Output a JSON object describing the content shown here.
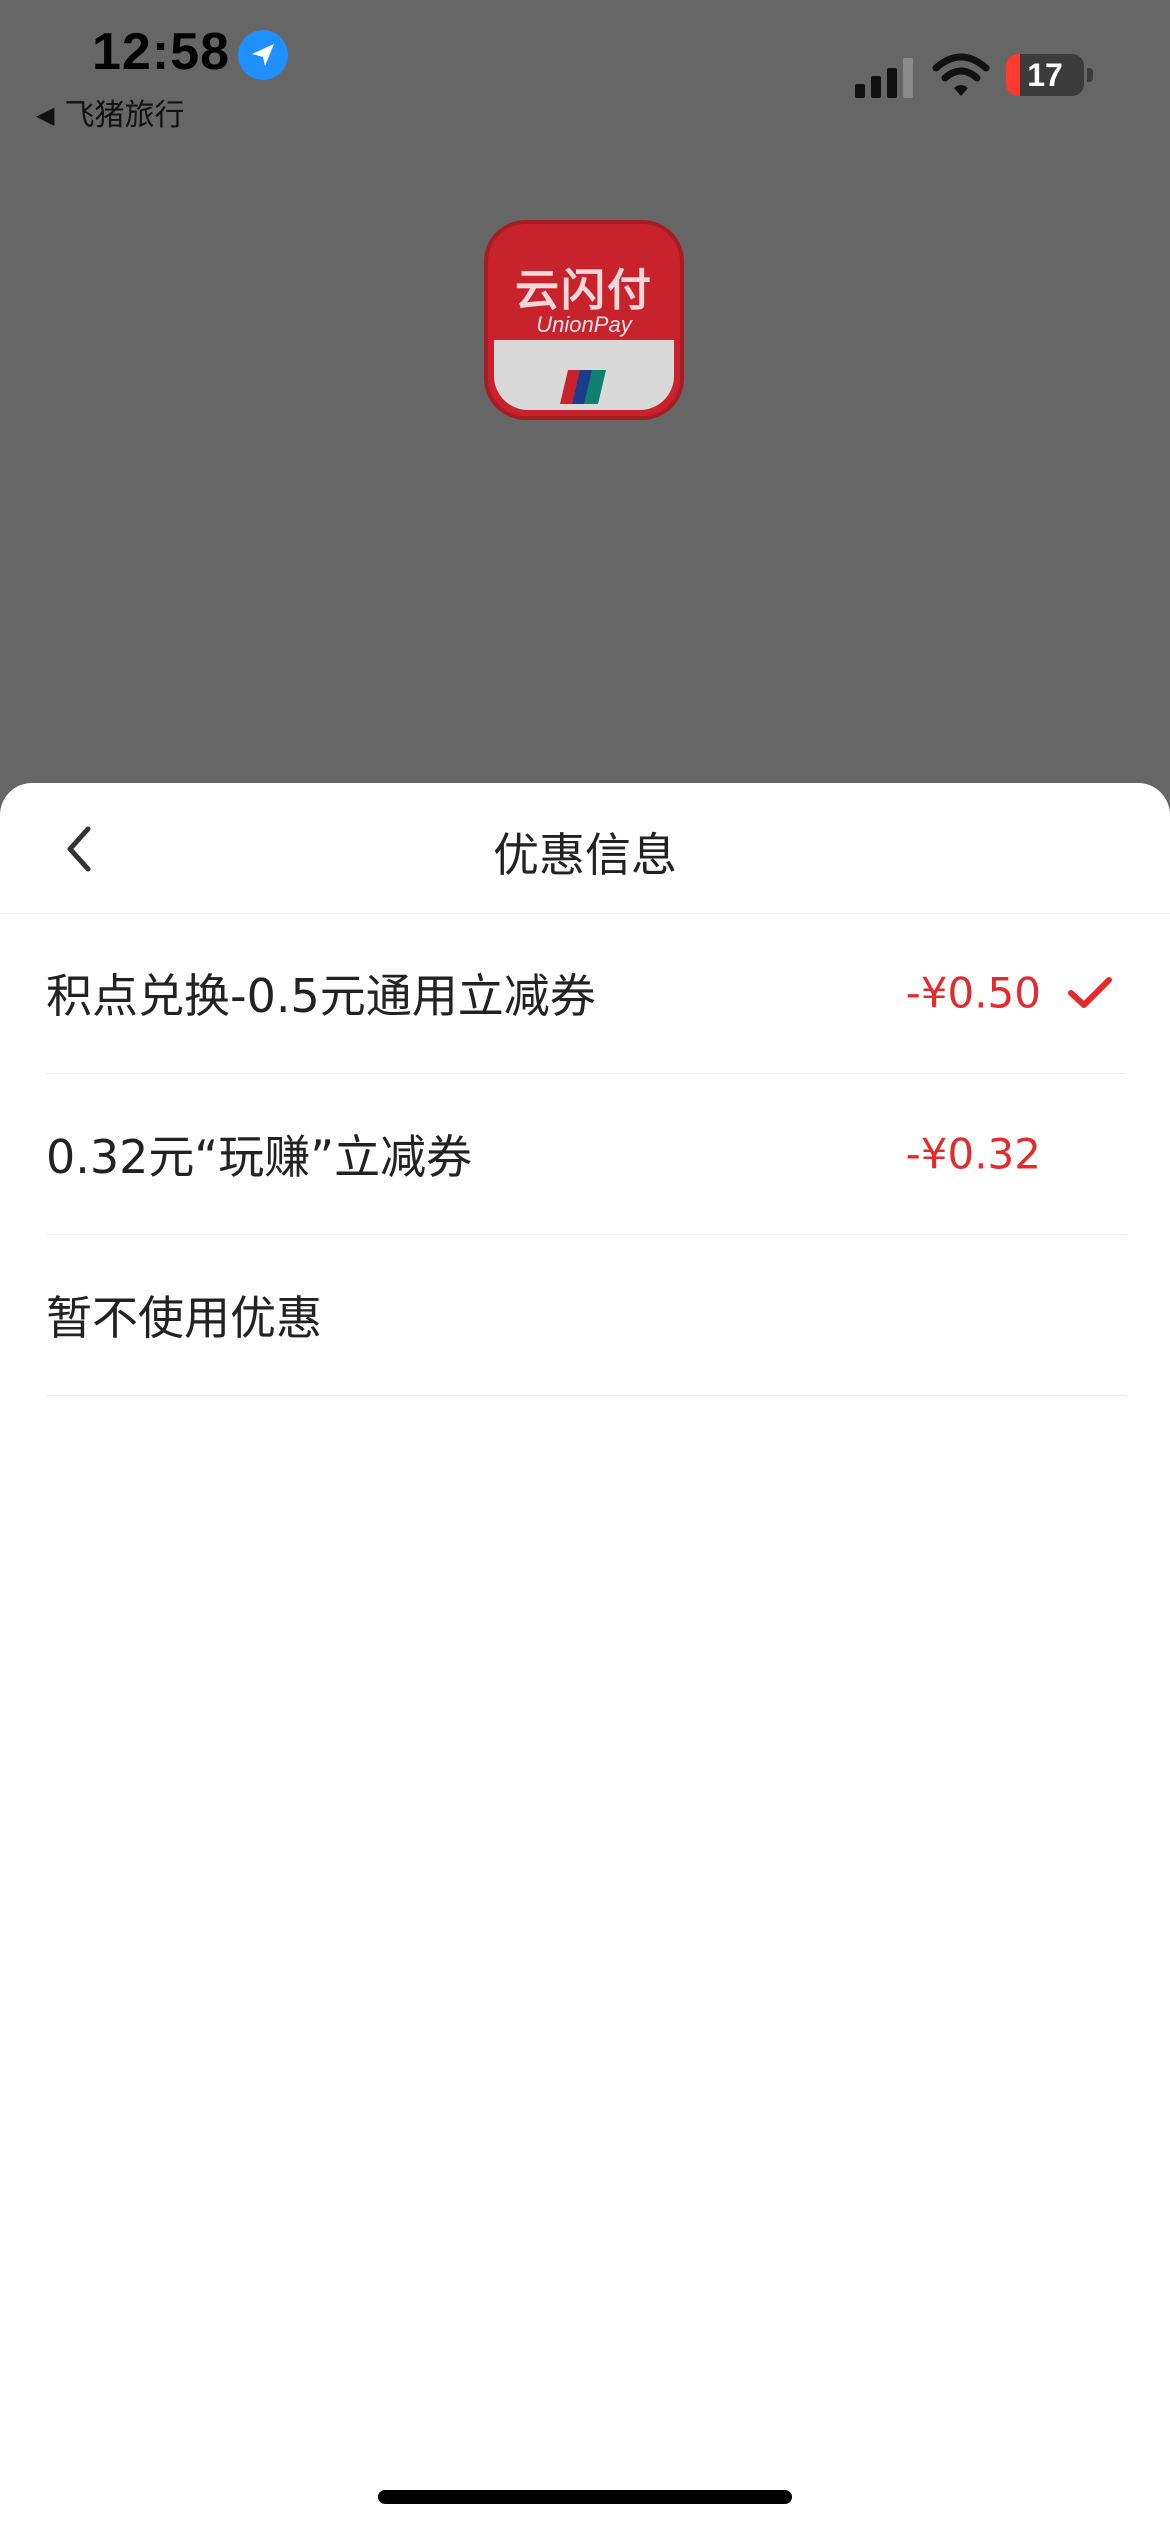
{
  "status_bar": {
    "time": "12:58",
    "back_app": "飞猪旅行",
    "battery": "17",
    "icons": [
      "location-icon",
      "signal-icon",
      "wifi-icon",
      "battery-icon"
    ]
  },
  "app_logo": {
    "title": "云闪付",
    "subtitle": "UnionPay"
  },
  "sheet": {
    "title": "优惠信息",
    "options": [
      {
        "label": "积点兑换-0.5元通用立减券",
        "amount": "-¥0.50",
        "selected": true
      },
      {
        "label": "0.32元“玩赚”立减券",
        "amount": "-¥0.32",
        "selected": false
      },
      {
        "label": "暂不使用优惠",
        "amount": "",
        "selected": false
      }
    ]
  },
  "colors": {
    "accent_red": "#e22b2b",
    "overlay_gray": "#666666",
    "location_blue": "#1E90FF"
  }
}
